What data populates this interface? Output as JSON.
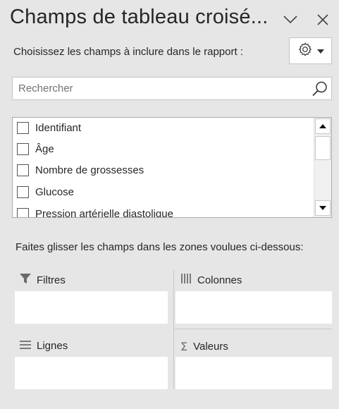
{
  "header": {
    "title": "Champs de tableau croisé...",
    "collapse_icon": "chevron-down-icon",
    "close_icon": "close-icon"
  },
  "prompt": "Choisissez les champs à inclure dans le rapport :",
  "tools_button": {
    "icon": "gear-icon",
    "dropdown_icon": "caret-down-icon"
  },
  "search": {
    "placeholder": "Rechercher",
    "value": "",
    "icon": "search-icon"
  },
  "fields": [
    {
      "label": "Identifiant",
      "checked": false
    },
    {
      "label": "Âge",
      "checked": false
    },
    {
      "label": "Nombre de grossesses",
      "checked": false
    },
    {
      "label": "Glucose",
      "checked": false
    },
    {
      "label": "Pression artérielle diastolique",
      "checked": false
    }
  ],
  "drag_instruction": "Faites glisser les champs dans les zones voulues ci-dessous:",
  "zones": {
    "filters": {
      "label": "Filtres",
      "icon": "filter-icon"
    },
    "columns": {
      "label": "Colonnes",
      "icon": "columns-icon"
    },
    "rows": {
      "label": "Lignes",
      "icon": "rows-icon"
    },
    "values": {
      "label": "Valeurs",
      "icon": "sigma-icon"
    }
  }
}
